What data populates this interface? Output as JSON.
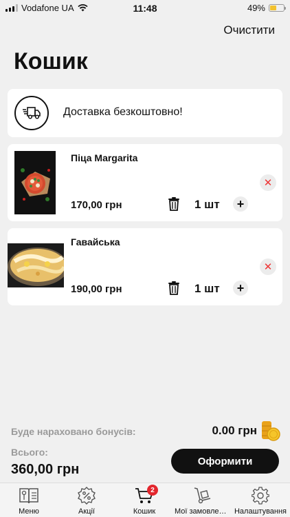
{
  "status_bar": {
    "carrier": "Vodafone UA",
    "time": "11:48",
    "battery": "49%",
    "battery_level": 0.49,
    "battery_color": "#f2c230"
  },
  "header": {
    "clear_label": "Очистити",
    "title": "Кошик"
  },
  "delivery": {
    "icon": "delivery-truck-icon",
    "text": "Доставка безкоштовно!"
  },
  "items": [
    {
      "name": "Піца Margarita",
      "price": "170,00 грн",
      "quantity": "1 шт",
      "image": "pizza-margarita-image"
    },
    {
      "name": "Гавайська",
      "price": "190,00 грн",
      "quantity": "1 шт",
      "image": "pizza-hawaiian-image"
    }
  ],
  "summary": {
    "bonus_label": "Буде нараховано бонусів:",
    "bonus_value": "0.00 грн",
    "total_label": "Всього:",
    "total_value": "360,00 грн",
    "checkout_label": "Оформити"
  },
  "tabbar": {
    "tabs": [
      {
        "label": "Меню",
        "icon": "menu-book-icon"
      },
      {
        "label": "Акції",
        "icon": "discount-badge-icon"
      },
      {
        "label": "Кошик",
        "icon": "cart-icon",
        "badge": "2",
        "active": true
      },
      {
        "label": "Мої замовлення",
        "icon": "hand-truck-icon"
      },
      {
        "label": "Налаштування",
        "icon": "gear-icon"
      }
    ]
  },
  "colors": {
    "accent": "#111111",
    "badge": "#e3262d",
    "remove": "#e33333",
    "background": "#f0f0f0",
    "muted_text": "#9a9a9a"
  }
}
